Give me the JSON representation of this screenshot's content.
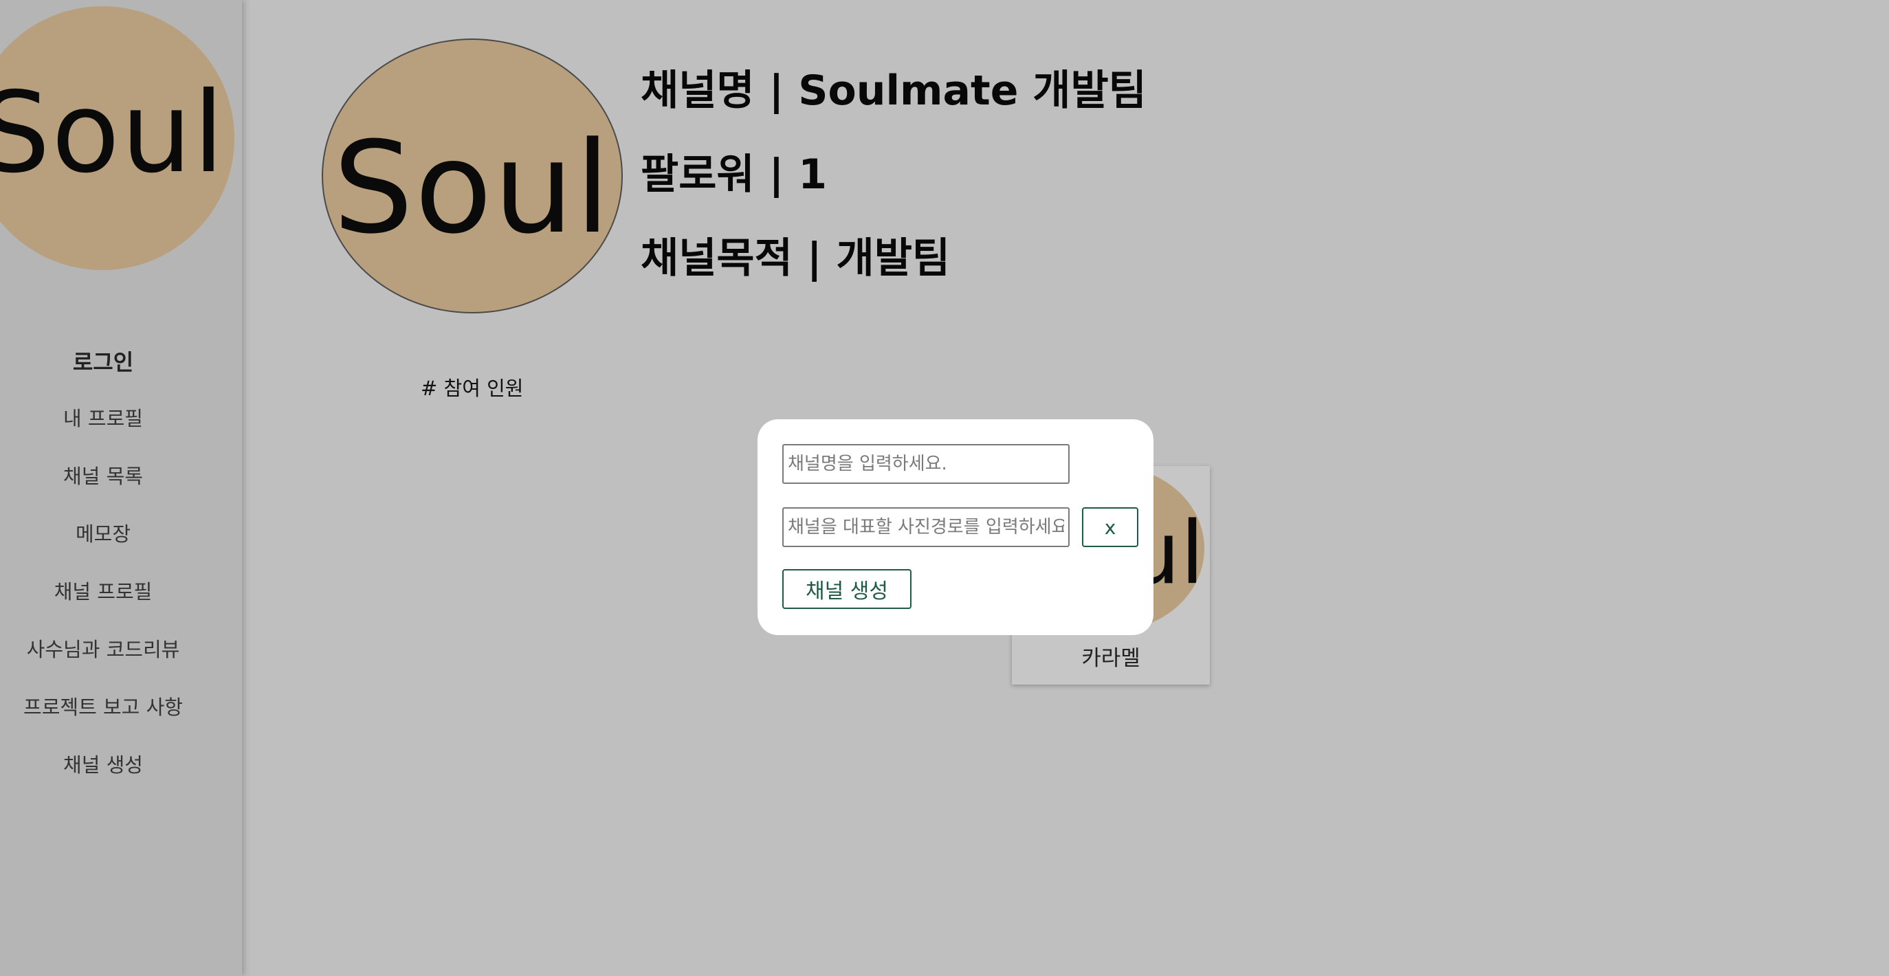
{
  "sidebar": {
    "logo_text": "Soul",
    "nav": {
      "login": "로그인",
      "my_profile": "내 프로필",
      "channel_list": "채널 목록",
      "memo": "메모장",
      "channel_profile": "채널 프로필",
      "code_review": "사수님과 코드리뷰",
      "project_report": "프로젝트 보고 사항",
      "create_channel": "채널 생성"
    }
  },
  "channel": {
    "avatar_text": "Soul",
    "name_line": "채널명 | Soulmate 개발팀",
    "followers_line": "팔로워 | 1",
    "purpose_line": "채널목적 | 개발팀"
  },
  "members": {
    "section_label": "# 참여 인원",
    "items": [
      {
        "avatar_text": "Soul",
        "name": "카라멜"
      }
    ]
  },
  "modal": {
    "name_input": {
      "value": "",
      "placeholder": "채널명을 입력하세요."
    },
    "photo_input": {
      "value": "",
      "placeholder": "채널을 대표할 사진경로를 입력하세요."
    },
    "close_label": "x",
    "create_label": "채널 생성"
  },
  "colors": {
    "background": "#bfbfbf",
    "sidebar": "#b5b5b5",
    "logo_fill": "#b8a07e",
    "accent": "#1f5a43"
  }
}
